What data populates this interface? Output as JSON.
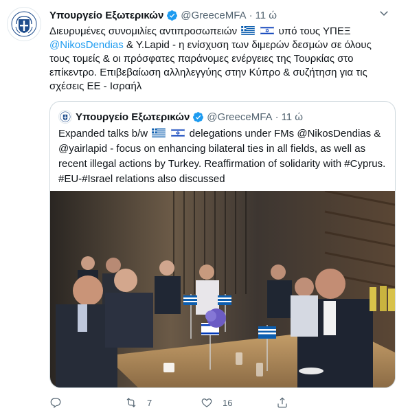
{
  "tweet": {
    "author_name": "Υπουργείο Εξωτερικών",
    "handle": "@GreeceMFA",
    "separator": "·",
    "time": "11 ώ",
    "text": {
      "part1": "Διευρυμένες συνομιλίες αντιπροσωπειών",
      "part2": "υπό τους ΥΠΕΞ",
      "mention": "@NikosDendias",
      "part3": "& Y.Lapid - η ενίσχυση των διμερών δεσμών σε όλους τους τομείς & οι πρόσφατες παράνομες ενέργειες της Τουρκίας στο επίκεντρο. Επιβεβαίωση αλληλεγγύης στην Κύπρο & συζήτηση για τις σχέσεις ΕΕ - Ισραήλ"
    },
    "flags": [
      "greece-flag",
      "israel-flag"
    ],
    "more_icon": "more-icon"
  },
  "quoted": {
    "author_name": "Υπουργείο Εξωτερικών",
    "handle": "@GreeceMFA",
    "separator": "·",
    "time": "11 ώ",
    "text": {
      "part1": "Expanded talks b/w",
      "part2": "delegations under FMs @NikosDendias & @yairlapid - focus on enhancing bilateral ties in all fields, as well as recent illegal actions by Turkey. Reaffirmation of solidarity with #Cyprus. #EU-#Israel relations also discussed"
    },
    "photo": "photo-meeting"
  },
  "actions": {
    "reply": {
      "icon": "reply-icon",
      "count": ""
    },
    "retweet": {
      "icon": "retweet-icon",
      "count": "7"
    },
    "like": {
      "icon": "heart-icon",
      "count": "16"
    },
    "share": {
      "icon": "share-icon",
      "count": ""
    }
  },
  "colors": {
    "link": "#1d9bf0",
    "verified": "#1d9bf0",
    "secondary_text": "#536471",
    "border": "#cfd9de",
    "greece_blue": "#0d5eaf",
    "israel_blue": "#0038b8"
  }
}
